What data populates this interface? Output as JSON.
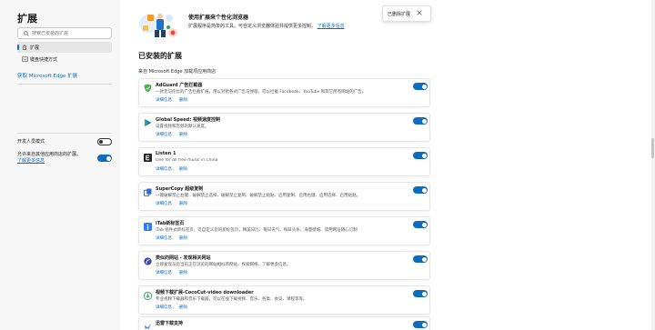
{
  "sidebar": {
    "title": "扩展",
    "search_placeholder": "搜索已安装的扩展",
    "nav": [
      {
        "label": "扩展",
        "icon": "puzzle-icon",
        "active": true
      },
      {
        "label": "键盘快捷方式",
        "icon": "keyboard-icon",
        "active": false
      }
    ],
    "get_extensions_link": "获取 Microsoft Edge 扩展",
    "developer_mode_label": "开发人员模式",
    "developer_mode_on": false,
    "allow_other_stores_text": "允许来自其他应用商店的扩展。",
    "allow_other_stores_link": "了解更多信息",
    "allow_other_stores_on": true
  },
  "hero": {
    "title": "使用扩展来个性化浏览器",
    "description": "扩展程序是简单的工具，可自定义浏览器体验并提供更多控制。",
    "learn_more": "了解更多信息"
  },
  "toast": {
    "text": "已删除扩展"
  },
  "installed": {
    "title": "已安装的扩展",
    "source_label": "来自 Microsoft Edge 加载项应用商店",
    "details_label": "详细信息",
    "remove_label": "删除",
    "extensions": [
      {
        "name": "AdGuard 广告拦截器",
        "description": "一款无与伦比的广告拦截扩展，用以对抗各式广告与弹窗。可以拦截 Facebook、YouTube 和其它所有网站的广告。",
        "icon": "adguard-shield-icon",
        "color": "#4caf50",
        "enabled": true
      },
      {
        "name": "Global Speed: 视频速度控制",
        "description": "设置视频和音频的默认速度。",
        "icon": "play-triangle-icon",
        "color": "#1a73c8",
        "enabled": true
      },
      {
        "name": "Listen 1",
        "description": "One for all free music in China",
        "icon": "listen1-e-icon",
        "color": "#222222",
        "enabled": true
      },
      {
        "name": "SuperCopy 超级复制",
        "description": "一键破解禁止右键、破解禁止选择、破解禁止复制、破解禁止粘贴、启用复制、启用右键、启用选择、启用粘贴。",
        "icon": "supercopy-icon",
        "color": "#2a6fd6",
        "enabled": true
      },
      {
        "name": "iTab新标签页",
        "description": "iTab 组件式新标签页，可自定义您的新标签页，精美日历、每日天气、每日头条、海量壁纸、常用网址随心订制",
        "icon": "itab-icon",
        "color": "#2d7df6",
        "enabled": true
      },
      {
        "name": "类似的网站 - 发现相关网站",
        "description": "立即发现与您当前正在浏览的网站相似的网站。探索网络，了解更多信息。",
        "icon": "similar-sites-icon",
        "color": "#3949ab",
        "enabled": true
      },
      {
        "name": "视频下载扩展-CocoCut-video downloader",
        "description": "专业视频下载器和音乐下载器，可以在线下载视频、音乐、各类、会议、课程等等。",
        "icon": "cococut-icon",
        "color": "#2e9e5b",
        "enabled": true
      },
      {
        "name": "迅雷下载支持",
        "description": "",
        "icon": "xunlei-bird-icon",
        "color": "#3a8ee6",
        "enabled": true
      }
    ]
  }
}
